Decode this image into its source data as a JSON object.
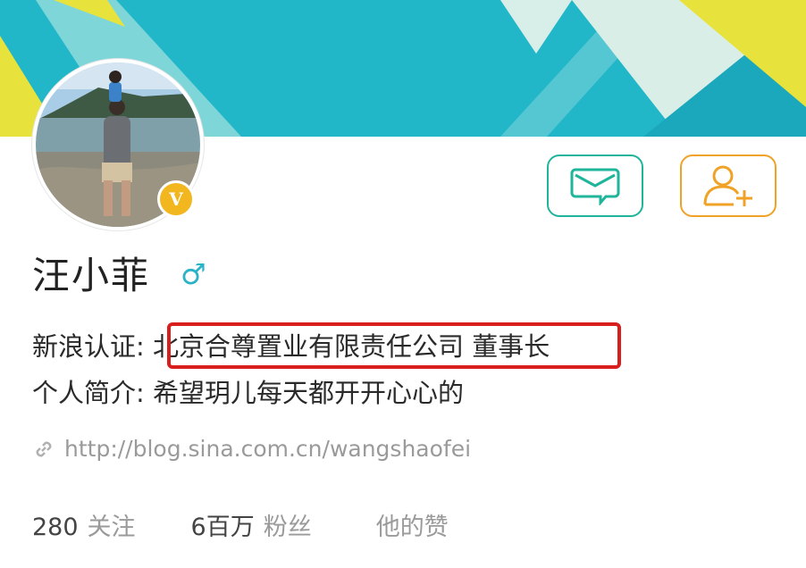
{
  "profile": {
    "name": "汪小菲",
    "gender_symbol": "♂",
    "verified_badge": "V",
    "certification_label": "新浪认证:",
    "certification_value": "北京合尊置业有限责任公司 董事长",
    "bio_label": "个人简介:",
    "bio_value": "希望玥儿每天都开开心心的",
    "blog_url": "http://blog.sina.com.cn/wangshaofei"
  },
  "actions": {
    "message_icon": "message-icon",
    "follow_icon": "add-user-icon"
  },
  "stats": {
    "following_count": "280",
    "following_label": "关注",
    "followers_count": "6百万",
    "followers_label": "粉丝",
    "likes_label": "他的赞"
  },
  "colors": {
    "banner_teal": "#21b7c9",
    "banner_yellow": "#e7e23c",
    "message_accent": "#1fb59b",
    "follow_accent": "#f0a227",
    "verified_badge": "#f2b71f",
    "highlight_box": "#d91e1e"
  }
}
